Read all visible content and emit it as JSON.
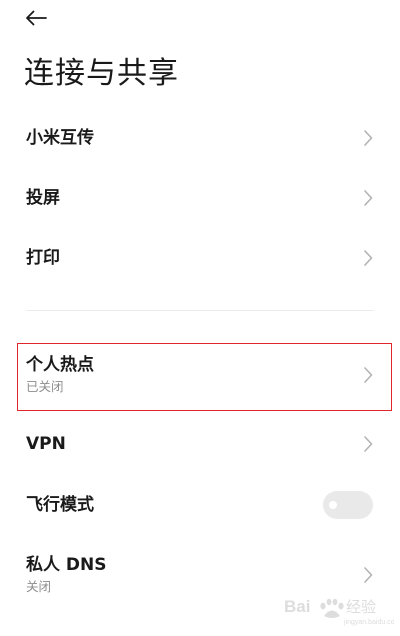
{
  "header": {
    "back_icon": "arrow-left-icon",
    "title": "连接与共享"
  },
  "items": [
    {
      "label": "小米互传",
      "icon": "chevron-right-icon"
    },
    {
      "label": "投屏",
      "icon": "chevron-right-icon"
    },
    {
      "label": "打印",
      "icon": "chevron-right-icon"
    },
    {
      "label": "个人热点",
      "subtitle": "已关闭",
      "icon": "chevron-right-icon",
      "highlighted": true
    },
    {
      "label": "VPN",
      "icon": "chevron-right-icon"
    },
    {
      "label": "飞行模式",
      "toggle": "off"
    },
    {
      "label": "私人 DNS",
      "subtitle": "关闭",
      "icon": "chevron-right-icon"
    }
  ],
  "colors": {
    "highlight_border": "#e0262a",
    "subtitle_text": "#8c8c8c",
    "toggle_track_off": "#e9e9e9"
  },
  "watermark": {
    "text": "Baidu 经验",
    "icon": "baidu-paw-logo"
  }
}
